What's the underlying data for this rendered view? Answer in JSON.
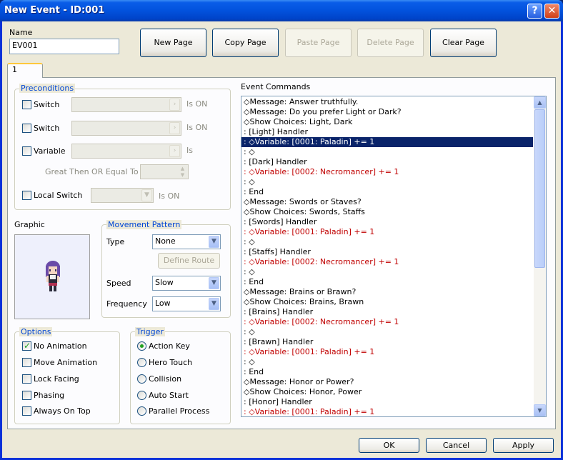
{
  "window": {
    "title": "New Event - ID:001"
  },
  "name_field": {
    "label": "Name",
    "value": "EV001"
  },
  "page_buttons": {
    "new_page": "New Page",
    "copy_page": "Copy Page",
    "paste_page": "Paste Page",
    "delete_page": "Delete Page",
    "clear_page": "Clear Page"
  },
  "tab": {
    "label": "1"
  },
  "preconditions": {
    "title": "Preconditions",
    "switch1": {
      "label": "Switch",
      "suffix": "Is ON"
    },
    "switch2": {
      "label": "Switch",
      "suffix": "Is ON"
    },
    "variable": {
      "label": "Variable",
      "suffix": "Is"
    },
    "gte_label": "Great Then OR Equal To",
    "local_switch": {
      "label": "Local Switch",
      "suffix": "Is ON"
    }
  },
  "graphic": {
    "label": "Graphic"
  },
  "movement": {
    "title": "Movement Pattern",
    "type_label": "Type",
    "type_value": "None",
    "define_route": "Define Route",
    "speed_label": "Speed",
    "speed_value": "Slow",
    "frequency_label": "Frequency",
    "frequency_value": "Low"
  },
  "options": {
    "title": "Options",
    "items": [
      {
        "label": "No Animation",
        "checked": true
      },
      {
        "label": "Move Animation",
        "checked": false
      },
      {
        "label": "Lock Facing",
        "checked": false
      },
      {
        "label": "Phasing",
        "checked": false
      },
      {
        "label": "Always On Top",
        "checked": false
      }
    ]
  },
  "trigger": {
    "title": "Trigger",
    "items": [
      {
        "label": "Action Key",
        "selected": true
      },
      {
        "label": "Hero Touch",
        "selected": false
      },
      {
        "label": "Collision",
        "selected": false
      },
      {
        "label": "Auto Start",
        "selected": false
      },
      {
        "label": "Parallel Process",
        "selected": false
      }
    ]
  },
  "event_commands": {
    "label": "Event Commands",
    "lines": [
      {
        "text": "◇Message: Answer truthfully.",
        "kind": "normal"
      },
      {
        "text": "◇Message: Do you prefer Light or Dark?",
        "kind": "normal"
      },
      {
        "text": "◇Show Choices: Light, Dark",
        "kind": "normal"
      },
      {
        "text": ":   [Light] Handler",
        "kind": "normal"
      },
      {
        "text": ":   ◇Variable: [0001: Paladin] += 1",
        "kind": "selected"
      },
      {
        "text": ":   ◇",
        "kind": "normal"
      },
      {
        "text": ":   [Dark] Handler",
        "kind": "normal"
      },
      {
        "text": ":   ◇Variable: [0002: Necromancer] += 1",
        "kind": "var"
      },
      {
        "text": ":   ◇",
        "kind": "normal"
      },
      {
        "text": ":   End",
        "kind": "normal"
      },
      {
        "text": "◇Message: Swords or Staves?",
        "kind": "normal"
      },
      {
        "text": "◇Show Choices: Swords, Staffs",
        "kind": "normal"
      },
      {
        "text": ":   [Swords] Handler",
        "kind": "normal"
      },
      {
        "text": ":   ◇Variable: [0001: Paladin] += 1",
        "kind": "var"
      },
      {
        "text": ":   ◇",
        "kind": "normal"
      },
      {
        "text": ":   [Staffs] Handler",
        "kind": "normal"
      },
      {
        "text": ":   ◇Variable: [0002: Necromancer] += 1",
        "kind": "var"
      },
      {
        "text": ":   ◇",
        "kind": "normal"
      },
      {
        "text": ":   End",
        "kind": "normal"
      },
      {
        "text": "◇Message: Brains or Brawn?",
        "kind": "normal"
      },
      {
        "text": "◇Show Choices: Brains, Brawn",
        "kind": "normal"
      },
      {
        "text": ":   [Brains] Handler",
        "kind": "normal"
      },
      {
        "text": ":   ◇Variable: [0002: Necromancer] += 1",
        "kind": "var"
      },
      {
        "text": ":   ◇",
        "kind": "normal"
      },
      {
        "text": ":   [Brawn] Handler",
        "kind": "normal"
      },
      {
        "text": ":   ◇Variable: [0001: Paladin] += 1",
        "kind": "var"
      },
      {
        "text": ":   ◇",
        "kind": "normal"
      },
      {
        "text": ":   End",
        "kind": "normal"
      },
      {
        "text": "◇Message: Honor or Power?",
        "kind": "normal"
      },
      {
        "text": "◇Show Choices: Honor, Power",
        "kind": "normal"
      },
      {
        "text": ":   [Honor] Handler",
        "kind": "normal"
      },
      {
        "text": ":   ◇Variable: [0001: Paladin] += 1",
        "kind": "var"
      }
    ]
  },
  "footer": {
    "ok": "OK",
    "cancel": "Cancel",
    "apply": "Apply"
  }
}
